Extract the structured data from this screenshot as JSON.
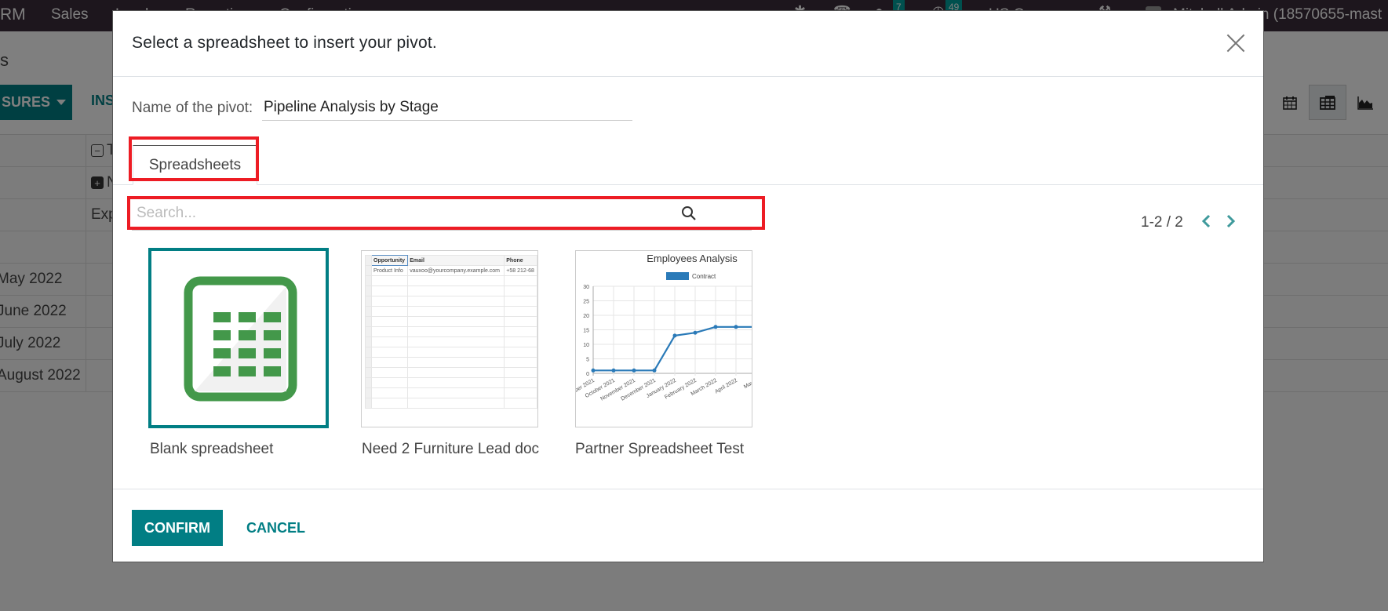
{
  "navbar": {
    "brand": "RM",
    "menu": [
      "Sales",
      "Leads",
      "Reporting",
      "Configuration"
    ],
    "messages_badge": "7",
    "activities_badge": "49",
    "company": "US Company",
    "user": "Mitchell Admin (18570655-mast"
  },
  "background": {
    "breadcrumb_fragment": "s",
    "measures_label": "SURES",
    "insert_label": "INS",
    "pivot_col_headers": [
      "T",
      "N",
      "Exp"
    ],
    "pivot_rows": [
      "May 2022",
      "June 2022",
      "July 2022",
      "August 2022"
    ]
  },
  "modal": {
    "title": "Select a spreadsheet to insert your pivot.",
    "name_label": "Name of the pivot:",
    "name_value": "Pipeline Analysis by Stage",
    "tab_label": "Spreadsheets",
    "search_placeholder": "Search...",
    "search_value": "",
    "pager": "1-2 / 2",
    "spreadsheets": [
      {
        "name": "Blank spreadsheet",
        "selected": true,
        "thumbnail": "blank-spreadsheet-icon"
      },
      {
        "name": "Need 2 Furniture Lead doc",
        "selected": false,
        "thumbnail": "sheet-preview",
        "preview_headers": [
          "Opportunity",
          "Email",
          "Phone"
        ],
        "preview_row": [
          "Product Info",
          "vauxoo@yourcompany.example.com",
          "+58 212-68"
        ]
      },
      {
        "name": "Partner Spreadsheet Test",
        "selected": false,
        "thumbnail": "chart-preview",
        "chart": {
          "title": "Employees Analysis",
          "legend": "Contract",
          "y_ticks": [
            "0",
            "5",
            "10",
            "15",
            "20",
            "25",
            "30"
          ],
          "ylim": [
            0,
            30
          ],
          "x_labels": [
            "ber 2021",
            "October 2021",
            "November 2021",
            "December 2021",
            "January 2022",
            "February 2022",
            "March 2022",
            "April 2022",
            "May 2"
          ],
          "values": [
            1,
            1,
            1,
            1,
            13,
            14,
            16,
            16,
            16
          ]
        }
      }
    ],
    "confirm_label": "CONFIRM",
    "cancel_label": "CANCEL"
  },
  "colors": {
    "brand": "#017e84",
    "highlight": "#ed1c24",
    "sheet_green": "#43984a",
    "chart_line": "#2a7ab8"
  }
}
